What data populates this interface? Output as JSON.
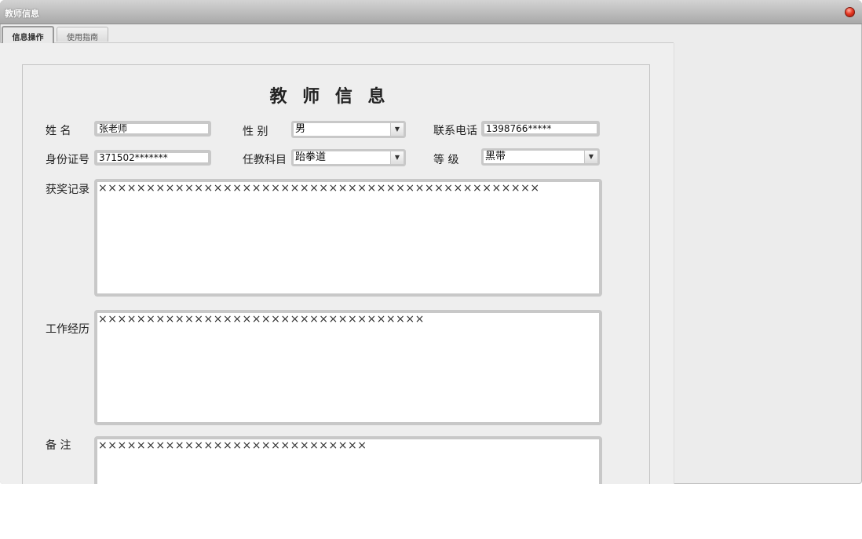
{
  "window": {
    "title": "教师信息"
  },
  "tabs": [
    {
      "label": "信息操作",
      "active": true
    },
    {
      "label": "使用指南",
      "active": false
    }
  ],
  "form": {
    "title": "教 师 信 息",
    "name_label": "姓  名",
    "name_value": "张老师",
    "gender_label": "性  别",
    "gender_value": "男",
    "phone_label": "联系电话",
    "phone_value": "1398766*****",
    "idcard_label": "身份证号",
    "idcard_value": "371502*******",
    "subject_label": "任教科目",
    "subject_value": "跆拳道",
    "level_label": "等  级",
    "level_value": "黑带",
    "awards_label": "获奖记录",
    "awards_value": "××××××××××××××××××××××××××××××××××××××××××××××",
    "work_label": "工作经历",
    "work_value": "××××××××××××××××××××××××××××××××××",
    "notes_label": "备  注",
    "notes_value": "××××××××××××××××××××××××××××"
  },
  "icons": {
    "close": "close-icon",
    "dropdown": "chevron-down-icon"
  },
  "colors": {
    "close_button": "#e83a25",
    "titlebar": "#a9a9a9"
  }
}
